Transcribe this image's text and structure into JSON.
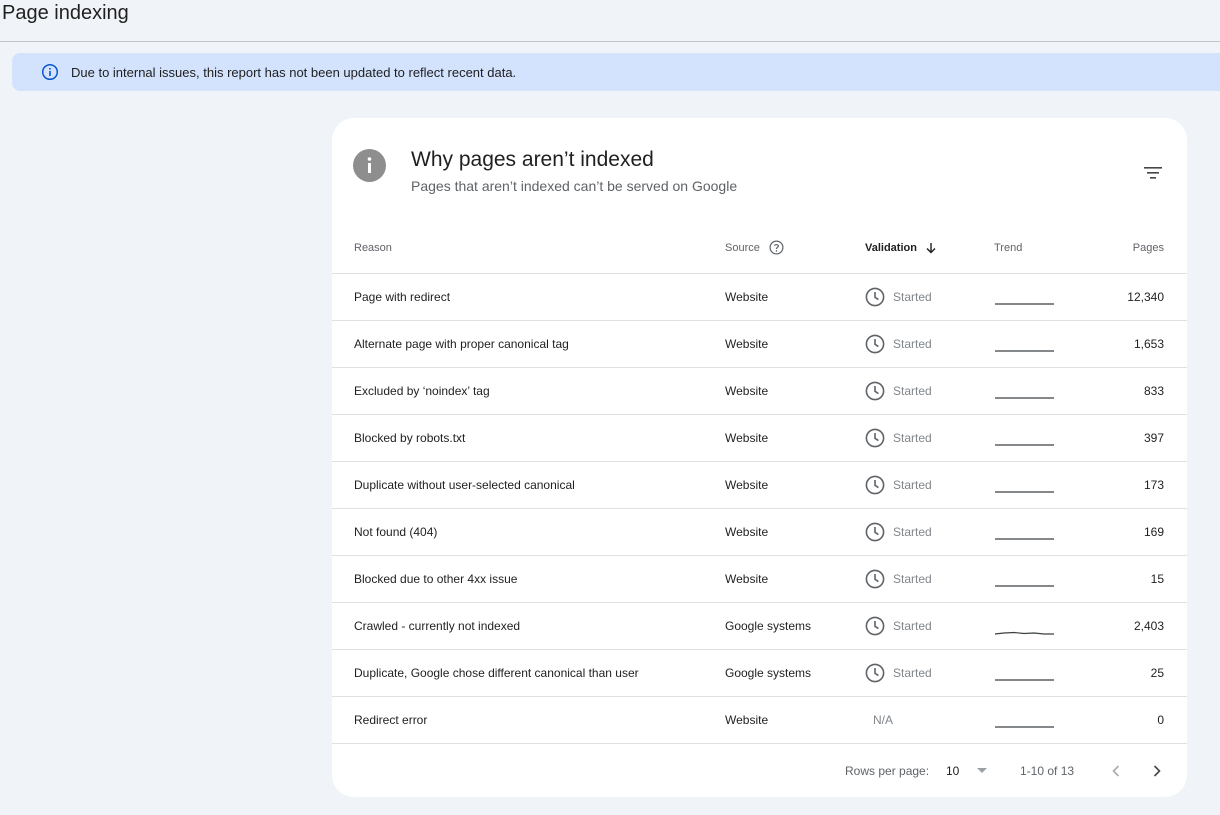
{
  "page": {
    "title": "Page indexing"
  },
  "banner": {
    "icon": "info-icon",
    "text": "Due to internal issues, this report has not been updated to reflect recent data."
  },
  "card": {
    "icon": "info-icon",
    "title": "Why pages aren’t indexed",
    "subtitle": "Pages that aren’t indexed can’t be served on Google",
    "filter_icon": "filter-icon"
  },
  "table": {
    "headers": {
      "reason": "Reason",
      "source": "Source",
      "validation": "Validation",
      "trend": "Trend",
      "pages": "Pages"
    },
    "sort": {
      "column": "validation",
      "direction": "descending"
    },
    "rows": [
      {
        "reason": "Page with redirect",
        "source": "Website",
        "validation": "Started",
        "pages": "12,340",
        "trend": "flat"
      },
      {
        "reason": "Alternate page with proper canonical tag",
        "source": "Website",
        "validation": "Started",
        "pages": "1,653",
        "trend": "flat"
      },
      {
        "reason": "Excluded by ‘noindex’ tag",
        "source": "Website",
        "validation": "Started",
        "pages": "833",
        "trend": "flat"
      },
      {
        "reason": "Blocked by robots.txt",
        "source": "Website",
        "validation": "Started",
        "pages": "397",
        "trend": "flat"
      },
      {
        "reason": "Duplicate without user-selected canonical",
        "source": "Website",
        "validation": "Started",
        "pages": "173",
        "trend": "flat"
      },
      {
        "reason": "Not found (404)",
        "source": "Website",
        "validation": "Started",
        "pages": "169",
        "trend": "flat"
      },
      {
        "reason": "Blocked due to other 4xx issue",
        "source": "Website",
        "validation": "Started",
        "pages": "15",
        "trend": "flat"
      },
      {
        "reason": "Crawled - currently not indexed",
        "source": "Google systems",
        "validation": "Started",
        "pages": "2,403",
        "trend": "wavy"
      },
      {
        "reason": "Duplicate, Google chose different canonical than user",
        "source": "Google systems",
        "validation": "Started",
        "pages": "25",
        "trend": "flat"
      },
      {
        "reason": "Redirect error",
        "source": "Website",
        "validation": "N/A",
        "pages": "0",
        "trend": "flat"
      }
    ]
  },
  "footer": {
    "rows_per_page_label": "Rows per page:",
    "rows_per_page_value": "10",
    "range": "1-10 of 13"
  },
  "colors": {
    "banner_bg": "#d3e3fd",
    "page_bg": "#f0f4f9",
    "info_blue": "#0b57d0"
  }
}
